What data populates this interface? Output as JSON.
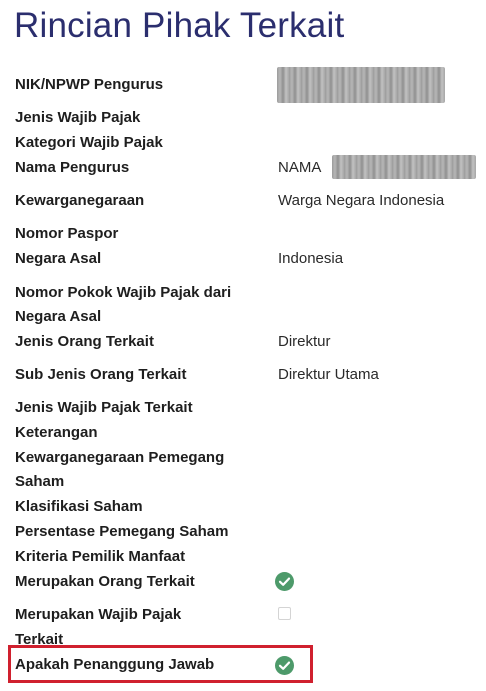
{
  "page": {
    "title": "Rincian Pihak Terkait"
  },
  "rows": [
    {
      "label": "NIK/NPWP Pengurus"
    },
    {
      "label": "Jenis Wajib Pajak"
    },
    {
      "label": "Kategori Wajib Pajak"
    },
    {
      "label": "Nama Pengurus",
      "value": "NAMA"
    },
    {
      "label": "Kewarganegaraan",
      "value": "Warga Negara Indonesia"
    },
    {
      "label": "Nomor Paspor"
    },
    {
      "label": "Negara Asal",
      "value": "Indonesia"
    },
    {
      "label_line1": "Nomor Pokok Wajib Pajak dari",
      "label_line2": "Negara Asal"
    },
    {
      "label": "Jenis Orang Terkait",
      "value": "Direktur"
    },
    {
      "label": "Sub Jenis Orang Terkait",
      "value": "Direktur Utama"
    },
    {
      "label": "Jenis Wajib Pajak Terkait"
    },
    {
      "label": "Keterangan"
    },
    {
      "label_line1": "Kewarganegaraan Pemegang",
      "label_line2": "Saham"
    },
    {
      "label": "Klasifikasi Saham"
    },
    {
      "label": "Persentase Pemegang Saham"
    },
    {
      "label": "Kriteria Pemilik Manfaat"
    },
    {
      "label": "Merupakan Orang Terkait",
      "checked": true
    },
    {
      "label_line1": "Merupakan Wajib Pajak",
      "label_line2": "Terkait",
      "checked": false
    },
    {
      "label": "Apakah Penanggung Jawab",
      "checked": true
    }
  ],
  "colors": {
    "title": "#2b2e6e",
    "check": "#4d9a6a",
    "highlight": "#d0202e"
  }
}
